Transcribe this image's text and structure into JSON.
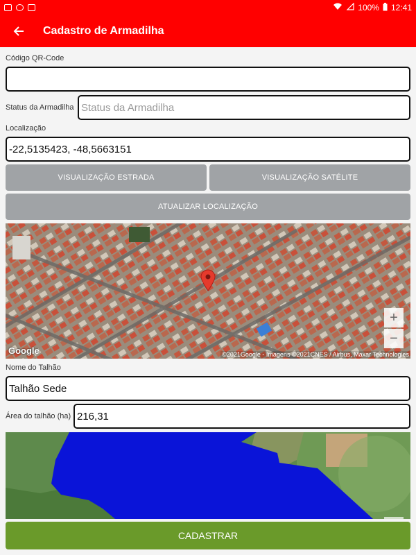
{
  "status_bar": {
    "battery": "100%",
    "time": "12:41"
  },
  "app_bar": {
    "title": "Cadastro de Armadilha"
  },
  "form": {
    "qr_label": "Código QR-Code",
    "qr_value": "",
    "status_label": "Status da Armadilha",
    "status_placeholder": "Status da Armadilha",
    "location_label": "Localização",
    "location_value": "-22,5135423, -48,5663151",
    "btn_road_view": "VISUALIZAÇÃO ESTRADA",
    "btn_satellite_view": "VISUALIZAÇÃO SATÉLITE",
    "btn_update_location": "ATUALIZAR LOCALIZAÇÃO",
    "plot_name_label": "Nome do Talhão",
    "plot_name_value": "Talhão Sede",
    "plot_area_label": "Área do talhão (ha)",
    "plot_area_value": "216,31",
    "submit_label": "CADASTRAR"
  },
  "map": {
    "zoom_in": "+",
    "zoom_out": "−",
    "google_logo": "Google",
    "attribution": "©2021Google - Imagens ©2021CNES / Airbus, Maxar Technologies"
  },
  "colors": {
    "app_bar": "#ff0000",
    "button_gray": "#a0a3a6",
    "submit_green": "#6a9a2a",
    "polygon_blue": "#0a14d8"
  }
}
